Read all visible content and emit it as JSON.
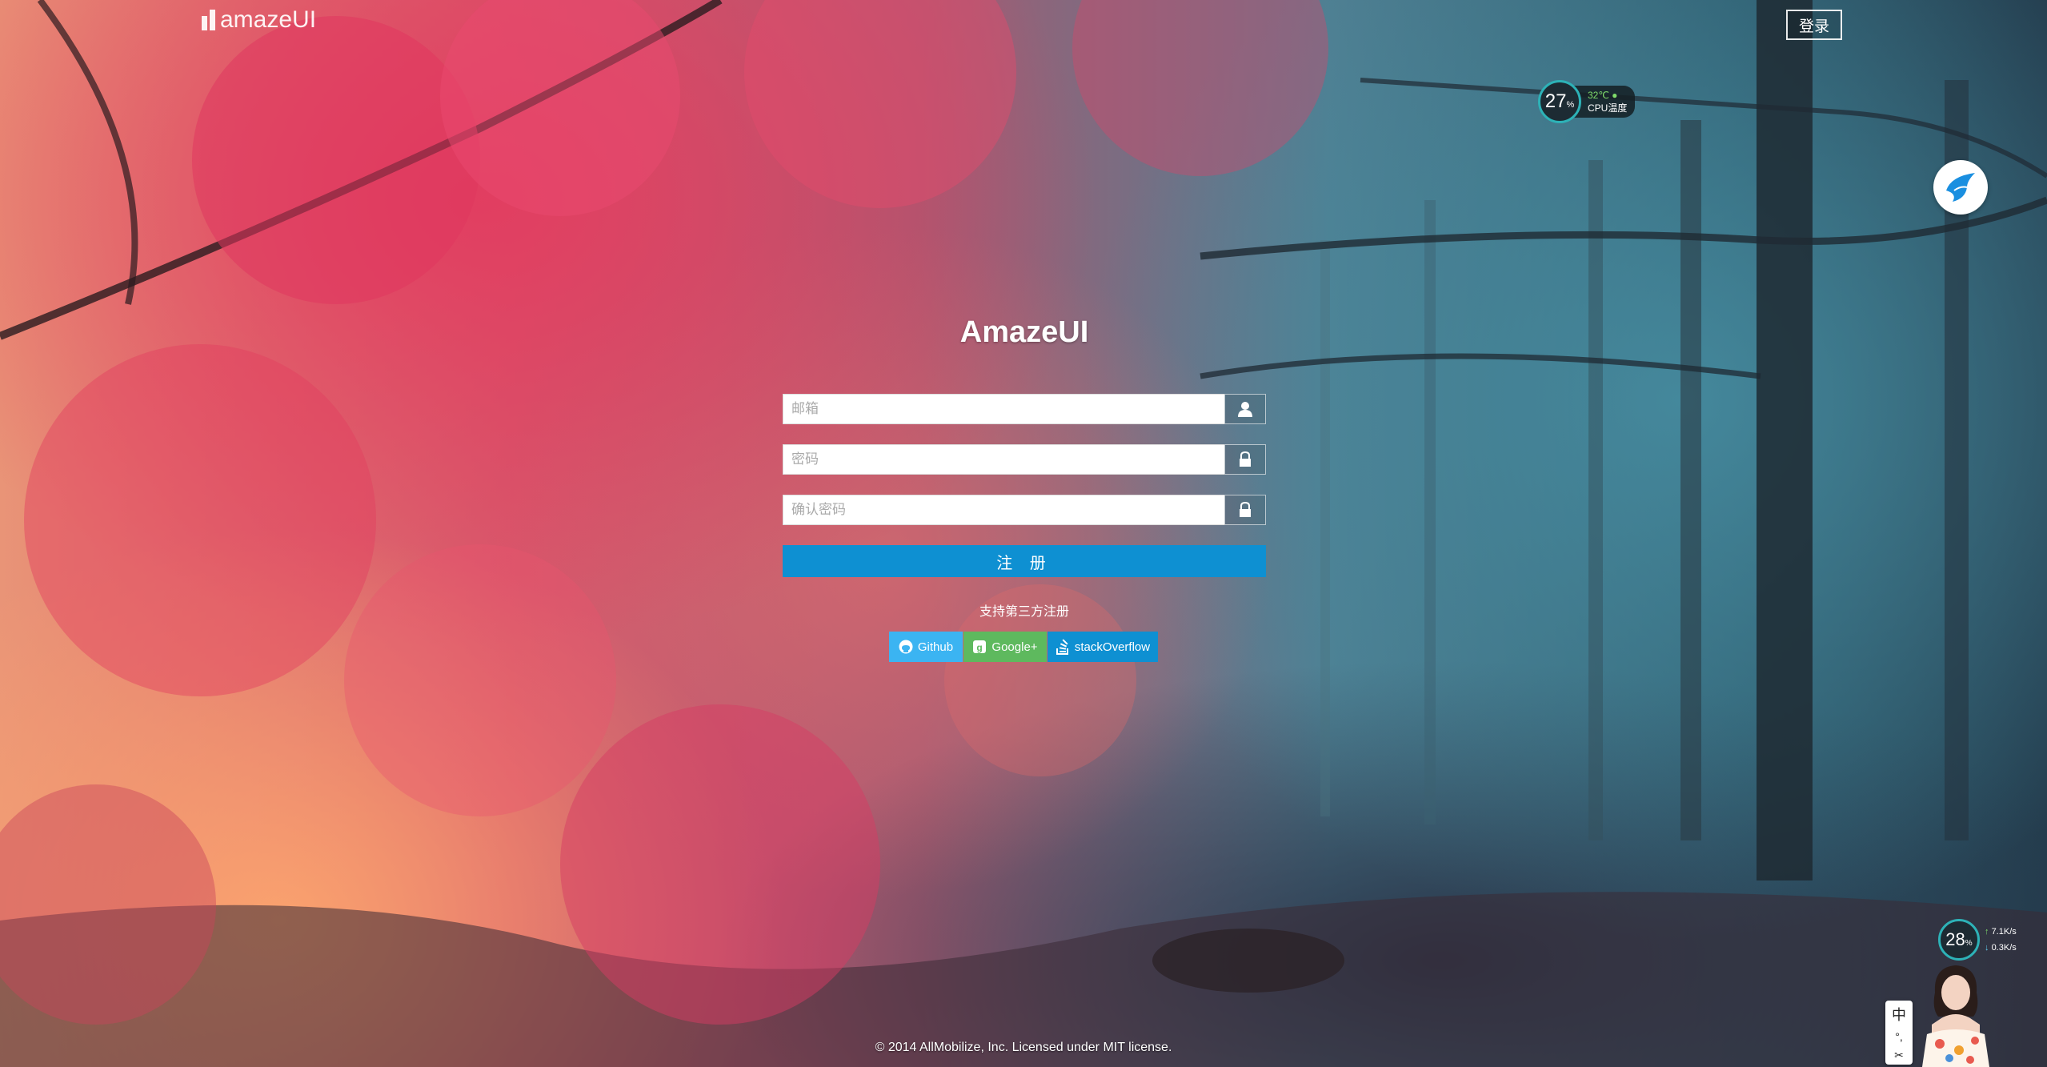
{
  "header": {
    "brand": "amazeUI",
    "login_button": "登录"
  },
  "cpu_widget": {
    "usage": "27",
    "unit": "%",
    "temperature": "32℃",
    "label": "CPU温度"
  },
  "form": {
    "title": "AmazeUI",
    "email_placeholder": "邮箱",
    "password_placeholder": "密码",
    "confirm_placeholder": "确认密码",
    "submit_label": "注 册",
    "third_party_label": "支持第三方注册"
  },
  "social": [
    {
      "label": "Github",
      "icon": "github-icon",
      "color": "#3bb4f2"
    },
    {
      "label": "Google+",
      "icon": "google-plus-icon",
      "color": "#5eb95e"
    },
    {
      "label": "stackOverflow",
      "icon": "stackoverflow-icon",
      "color": "#0e90d2"
    }
  ],
  "footer": {
    "text": "© 2014 AllMobilize, Inc. Licensed under MIT license."
  },
  "net_widget": {
    "usage": "28",
    "unit": "%",
    "up": "7.1K/s",
    "down": "0.3K/s"
  },
  "ime": {
    "lang": "中",
    "punct": "°,",
    "tool": "✂"
  },
  "colors": {
    "primary": "#0e90d2",
    "github": "#3bb4f2",
    "google": "#5eb95e",
    "widget_ring": "#2db2b7"
  }
}
